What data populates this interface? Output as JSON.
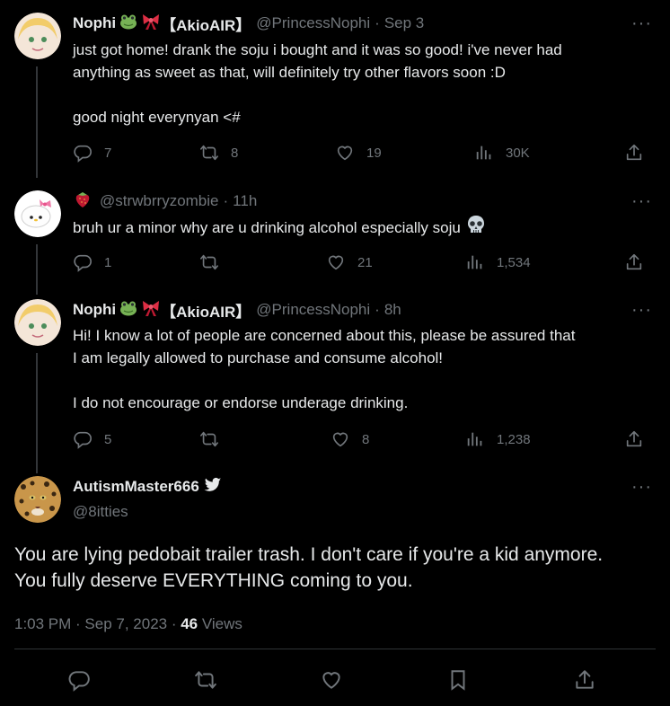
{
  "tweets": [
    {
      "display_name": "Nophi",
      "badge_text": "【AkioAIR】",
      "handle": "@PrincessNophi",
      "time": "Sep 3",
      "lines": [
        "just got home! drank the soju i bought and it was so good! i've never had",
        "anything as sweet as that, will definitely try other flavors soon :D"
      ],
      "line2": "good night everynyan <#",
      "replies": "7",
      "retweets": "8",
      "likes": "19",
      "views": "30K"
    },
    {
      "handle": "@strwbrryzombie",
      "time": "11h",
      "text": "bruh ur a minor why are u drinking alcohol especially soju",
      "replies": "1",
      "retweets": "",
      "likes": "21",
      "views": "1,534"
    },
    {
      "display_name": "Nophi",
      "badge_text": "【AkioAIR】",
      "handle": "@PrincessNophi",
      "time": "8h",
      "lines": [
        "Hi! I know a lot of people are concerned about this, please be assured that",
        "I am legally allowed to purchase and consume alcohol!"
      ],
      "line2": "I do not encourage or endorse underage drinking.",
      "replies": "5",
      "retweets": "",
      "likes": "8",
      "views": "1,238"
    }
  ],
  "main_tweet": {
    "display_name": "AutismMaster666",
    "handle": "@8itties",
    "lines": [
      "You are lying pedobait trailer trash. I don't care if you're a kid anymore.",
      "You fully deserve EVERYTHING coming to you."
    ],
    "timestamp": "1:03 PM · Sep 7, 2023 · ",
    "views_count": "46",
    "views_label": " Views"
  },
  "icons": [
    "frog-emoji",
    "ribbon-emoji",
    "strawberry-emoji",
    "skull-emoji",
    "bird-icon",
    "reply-icon",
    "retweet-icon",
    "like-icon",
    "views-icon",
    "share-icon",
    "bookmark-icon",
    "more-icon"
  ],
  "colors": {
    "background": "#000000",
    "text": "#e7e9ea",
    "muted": "#71767b",
    "thread_line": "#333639"
  }
}
